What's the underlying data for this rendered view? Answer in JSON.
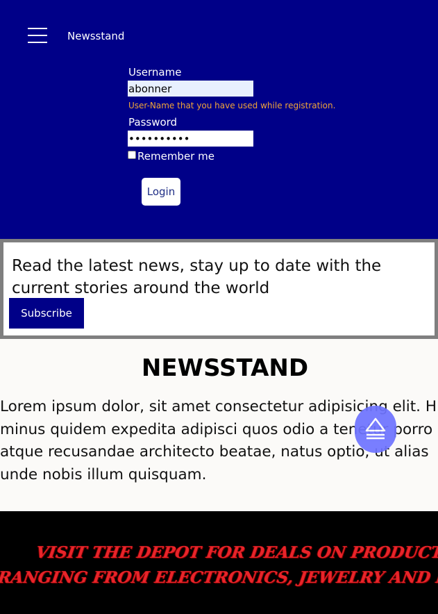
{
  "header": {
    "brand": "Newsstand",
    "menu_icon": "hamburger-menu-icon"
  },
  "login_form": {
    "username_label": "Username",
    "username_value": "abonner",
    "username_hint": "User-Name that you have used while registration.",
    "password_label": "Password",
    "password_value": "••••••••••",
    "remember_label": "Remember me",
    "remember_checked": false,
    "login_label": "Login"
  },
  "subscribe": {
    "text": "Read the latest news, stay up to date with the current stories around the world",
    "button_label": "Subscribe"
  },
  "article": {
    "title": "NEWSSTAND",
    "lines": [
      "Lorem ipsum dolor, sit amet consectetur adipisicing elit. Hic",
      "minus quidem expedita adipisci quos odio a tenetur porro",
      "atque recusandae architecto beatae, natus optio, ut alias",
      "unde nobis illum quisquam."
    ]
  },
  "scroll_top": {
    "icon": "eject-up-arrow-icon"
  },
  "promo": {
    "line1": "VISIT THE DEPOT FOR DEALS ON PRODUCTS",
    "line2": "RANGING FROM ELECTRONICS, JEWELRY AND MORE"
  },
  "colors": {
    "header_bg": "#000088",
    "hint": "#f0a43a",
    "accent": "#6f74ff",
    "promo_text": "#e8242a"
  }
}
